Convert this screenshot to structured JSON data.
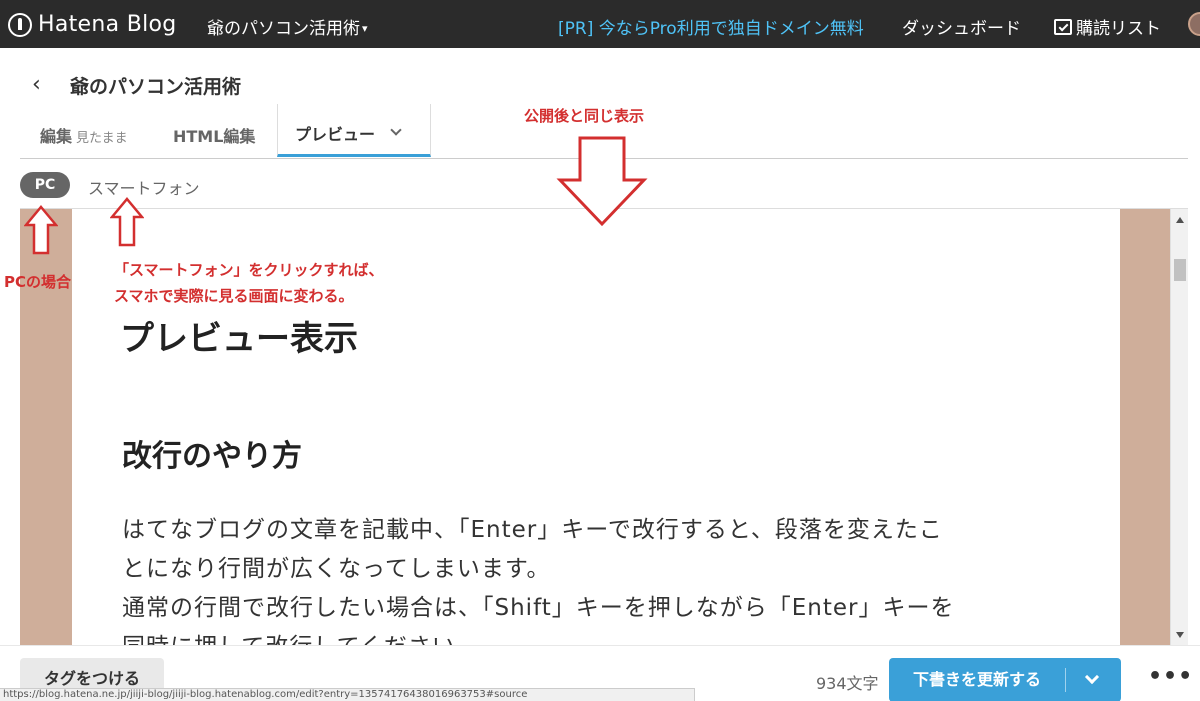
{
  "topbar": {
    "logo_text": "Hatena Blog",
    "blog_select": "爺のパソコン活用術",
    "pr_link": "[PR] 今ならPro利用で独自ドメイン無料",
    "dashboard": "ダッシュボード",
    "subscribe": "購読リスト"
  },
  "header": {
    "blog_name": "爺のパソコン活用術"
  },
  "tabs": {
    "edit": "編集",
    "edit_mode": "見たまま",
    "html": "HTML編集",
    "preview": "プレビュー"
  },
  "device": {
    "pc": "PC",
    "smartphone": "スマートフォン"
  },
  "preview": {
    "title": "プレビュー表示",
    "heading": "改行のやり方",
    "paragraph_lines": [
      "はてなブログの文章を記載中、「Enter」キーで改行すると、段落を変えたこ",
      "とになり行間が広くなってしまいます。",
      "通常の行間で改行したい場合は、「Shift」キーを押しながら「Enter」キーを",
      "同時に押して改行してください。"
    ],
    "background_color": "#cfae9a"
  },
  "annotations": {
    "top": "公開後と同じ表示",
    "pc": "PCの場合",
    "sp_line1": "「スマートフォン」をクリックすれば、",
    "sp_line2": "スマホで実際に見る画面に変わる。",
    "color": "#d32f2f"
  },
  "footer": {
    "tag_button": "タグをつける",
    "char_count": "934文字",
    "save_button": "下書きを更新する",
    "more": "•••",
    "status_url": "https://blog.hatena.ne.jp/jiiji-blog/jiiji-blog.hatenablog.com/edit?entry=13574176438016963753#source"
  },
  "colors": {
    "topbar": "#2b2b2b",
    "accent": "#3aa0d8",
    "pr_link": "#4fc3f7"
  }
}
